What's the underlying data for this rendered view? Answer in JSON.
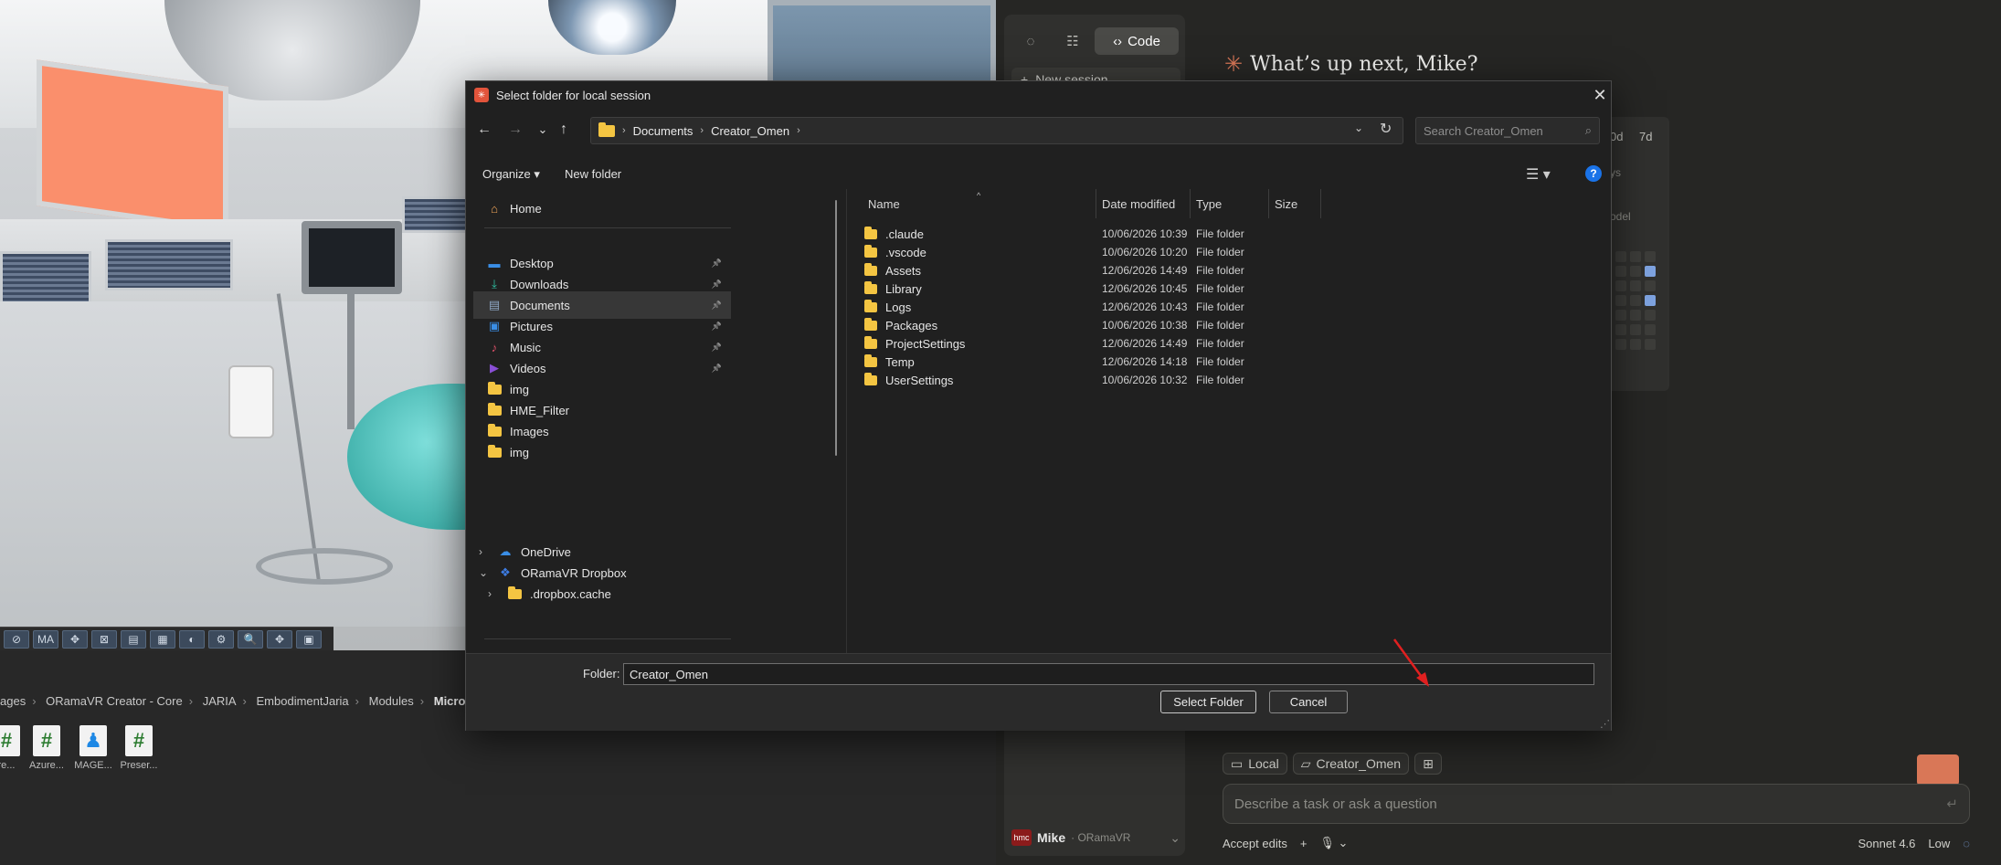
{
  "dialog": {
    "title": "Select folder for local session",
    "close_glyph": "✕",
    "nav": {
      "back": "←",
      "forward": "→",
      "recent": "⌄",
      "up": "↑"
    },
    "address": [
      "Documents",
      "Creator_Omen"
    ],
    "address_sep": "›",
    "search_placeholder": "Search Creator_Omen",
    "commands": {
      "organize": "Organize ▾",
      "new_folder": "New folder"
    },
    "sidebar": {
      "home": "Home",
      "quick": [
        {
          "label": "Desktop",
          "icon": "desktop-icon",
          "color": "#3a8ee6",
          "pinned": true
        },
        {
          "label": "Downloads",
          "icon": "downloads-icon",
          "color": "#2ec4a6",
          "pinned": true
        },
        {
          "label": "Documents",
          "icon": "documents-icon",
          "color": "#8ea7c4",
          "pinned": true,
          "selected": true
        },
        {
          "label": "Pictures",
          "icon": "pictures-icon",
          "color": "#3a8ee6",
          "pinned": true
        },
        {
          "label": "Music",
          "icon": "music-icon",
          "color": "#e0506a",
          "pinned": true
        },
        {
          "label": "Videos",
          "icon": "videos-icon",
          "color": "#8a4fd6",
          "pinned": true
        },
        {
          "label": "img",
          "icon": "folder-icon",
          "color": "#f4c542",
          "pinned": false
        },
        {
          "label": "HME_Filter",
          "icon": "folder-icon",
          "color": "#f4c542",
          "pinned": false
        },
        {
          "label": "Images",
          "icon": "folder-icon",
          "color": "#f4c542",
          "pinned": false
        },
        {
          "label": "img",
          "icon": "folder-icon",
          "color": "#f4c542",
          "pinned": false
        }
      ],
      "onedrive": "OneDrive",
      "dropbox": "ORamaVR Dropbox",
      "dropbox_child": ".dropbox.cache"
    },
    "columns": [
      "Name",
      "Date modified",
      "Type",
      "Size"
    ],
    "files": [
      {
        "name": ".claude",
        "date": "10/06/2026 10:39",
        "type": "File folder"
      },
      {
        "name": ".vscode",
        "date": "10/06/2026 10:20",
        "type": "File folder"
      },
      {
        "name": "Assets",
        "date": "12/06/2026 14:49",
        "type": "File folder"
      },
      {
        "name": "Library",
        "date": "12/06/2026 10:45",
        "type": "File folder"
      },
      {
        "name": "Logs",
        "date": "12/06/2026 10:43",
        "type": "File folder"
      },
      {
        "name": "Packages",
        "date": "10/06/2026 10:38",
        "type": "File folder"
      },
      {
        "name": "ProjectSettings",
        "date": "12/06/2026 14:49",
        "type": "File folder"
      },
      {
        "name": "Temp",
        "date": "12/06/2026 14:18",
        "type": "File folder"
      },
      {
        "name": "UserSettings",
        "date": "10/06/2026 10:32",
        "type": "File folder"
      }
    ],
    "footer": {
      "folder_label": "Folder:",
      "folder_value": "Creator_Omen",
      "select_label": "Select Folder",
      "cancel_label": "Cancel"
    }
  },
  "unity": {
    "toolbar": [
      "⊘",
      "MA",
      "✥",
      "⊠",
      "▤",
      "▦",
      "◐",
      "⚙",
      "🔍",
      "✥",
      "▣"
    ],
    "breadcrumb": [
      "ages",
      "ORamaVR Creator - Core",
      "JARIA",
      "EmbodimentJaria",
      "Modules"
    ],
    "breadcrumb_last": "MicrosoftCo",
    "assets": [
      {
        "icon": "#",
        "label": "re..."
      },
      {
        "icon": "#",
        "label": "Azure..."
      },
      {
        "icon": "♟",
        "label": "MAGE..."
      },
      {
        "icon": "#",
        "label": "Preser..."
      }
    ]
  },
  "claude": {
    "code_label": "Code",
    "new_session": "New session",
    "greeting": "What’s up next, Mike?",
    "range_30d": "0d",
    "range_7d": "7d",
    "stats_partial": [
      "ys",
      "odel"
    ],
    "chips": [
      "Local",
      "Creator_Omen"
    ],
    "prompt_placeholder": "Describe a task or ask a question",
    "accept_edits": "Accept edits",
    "model": "Sonnet 4.6",
    "effort": "Low",
    "user_name": "Mike",
    "org": "· ORamaVR",
    "accent": "#d97757"
  }
}
